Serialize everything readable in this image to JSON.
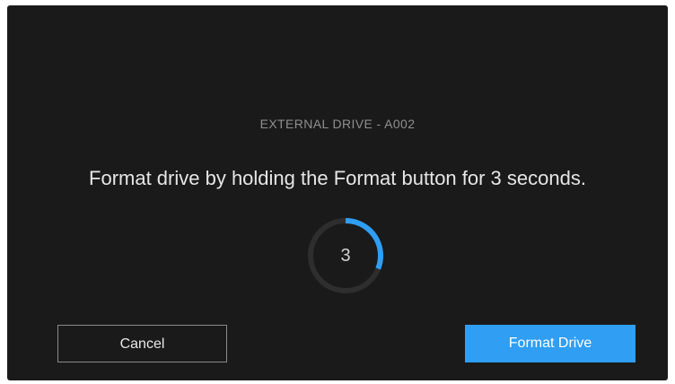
{
  "dialog": {
    "drive_label": "EXTERNAL DRIVE - A002",
    "message": "Format drive by holding the Format button for 3 seconds.",
    "countdown": "3",
    "hold_progress_fraction": 0.31
  },
  "buttons": {
    "cancel_label": "Cancel",
    "format_label": "Format Drive"
  },
  "colors": {
    "background": "#1a1a1a",
    "accent": "#2f9ef3",
    "ring_track": "#2e2e2e"
  }
}
